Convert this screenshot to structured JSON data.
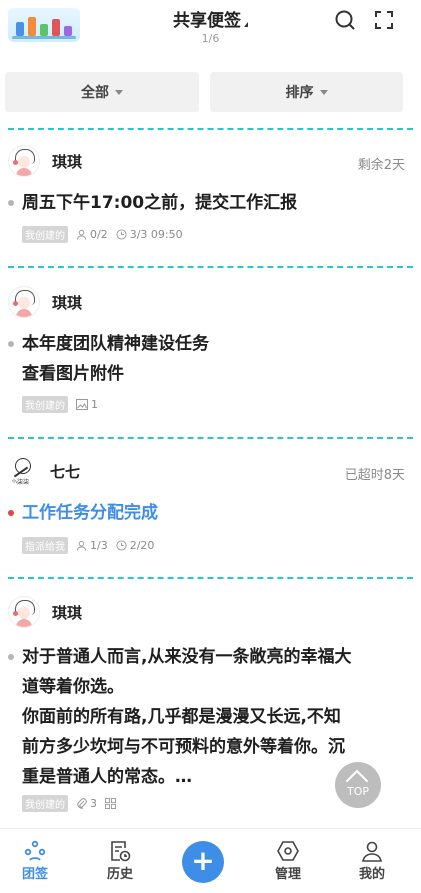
{
  "header": {
    "title": "共享便签",
    "page": "1/6"
  },
  "filters": {
    "all_label": "全部",
    "sort_label": "排序"
  },
  "cards": [
    {
      "author": "琪琪",
      "status": "剩余2天",
      "lines": [
        "周五下午17:00之前，提交工作汇报"
      ],
      "tag": "我创建的",
      "meta": [
        "0/2",
        "3/3 09:50"
      ]
    },
    {
      "author": "琪琪",
      "status": "",
      "lines": [
        "本年度团队精神建设任务",
        "查看图片附件"
      ],
      "tag": "我创建的",
      "meta": [
        "1"
      ]
    },
    {
      "author": "七七",
      "status": "已超时8天",
      "lines": [
        "工作任务分配完成"
      ],
      "tag": "指派给我",
      "meta": [
        "1/3",
        "2/20"
      ]
    },
    {
      "author": "琪琪",
      "status": "",
      "lines": [
        "对于普通人而言,从来没有一条敞亮的幸福大",
        "道等着你选。",
        "你面前的所有路,几乎都是漫漫又长远,不知",
        "前方多少坎坷与不可预料的意外等着你。沉",
        "重是普通人的常态。…"
      ],
      "tag": "我创建的",
      "meta": [
        "3"
      ]
    }
  ],
  "avatar_label_7": "小柒柒",
  "top_button": "TOP",
  "tabbar": {
    "items": [
      {
        "label": "团签",
        "icon": "team-icon"
      },
      {
        "label": "历史",
        "icon": "history-icon"
      },
      {
        "label": "",
        "icon": "plus-icon"
      },
      {
        "label": "管理",
        "icon": "manage-icon"
      },
      {
        "label": "我的",
        "icon": "profile-icon"
      }
    ]
  },
  "colors": {
    "accent": "#3e8ee8",
    "divider": "#29c4d6",
    "overdue": "#e24444"
  }
}
